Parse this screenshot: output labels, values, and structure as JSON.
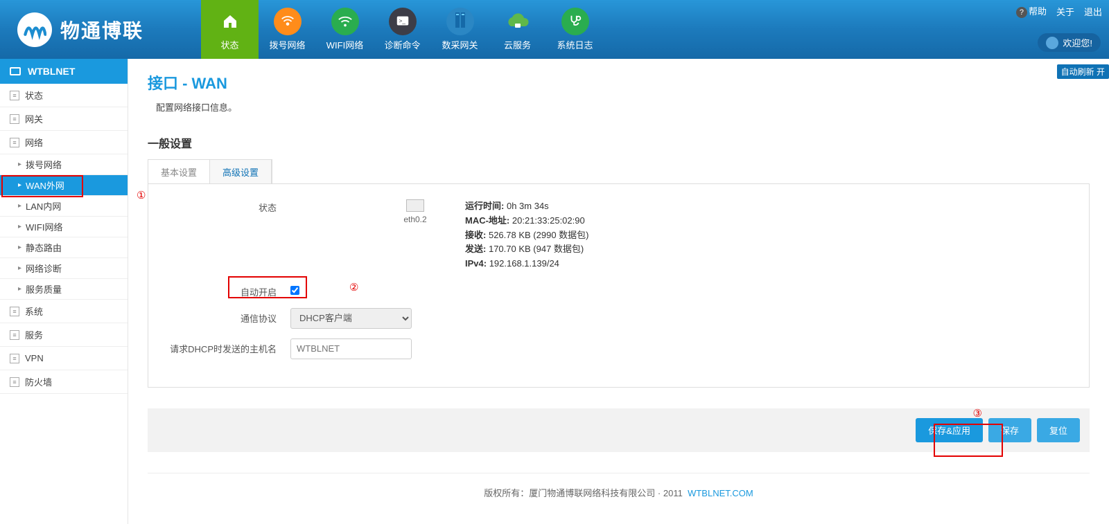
{
  "brand": "物通博联",
  "top_right": {
    "help": "帮助",
    "about": "关于",
    "logout": "退出"
  },
  "welcome": "欢迎您!",
  "topnav": [
    {
      "label": "状态",
      "icon": "home",
      "color": "green",
      "active": true
    },
    {
      "label": "拨号网络",
      "icon": "signal",
      "color": "orange"
    },
    {
      "label": "WIFI网络",
      "icon": "wifi",
      "color": "green2"
    },
    {
      "label": "诊断命令",
      "icon": "terminal",
      "color": "dark"
    },
    {
      "label": "数采网关",
      "icon": "server",
      "color": "blue"
    },
    {
      "label": "云服务",
      "icon": "cloud",
      "color": "cloud"
    },
    {
      "label": "系统日志",
      "icon": "stetho",
      "color": "green2"
    }
  ],
  "sidebar": {
    "title": "WTBLNET",
    "groups": [
      {
        "label": "状态"
      },
      {
        "label": "网关"
      },
      {
        "label": "网络",
        "expanded": true,
        "children": [
          {
            "label": "拨号网络"
          },
          {
            "label": "WAN外网",
            "active": true
          },
          {
            "label": "LAN内网"
          },
          {
            "label": "WIFI网络"
          },
          {
            "label": "静态路由"
          },
          {
            "label": "网络诊断"
          },
          {
            "label": "服务质量"
          }
        ]
      },
      {
        "label": "系统"
      },
      {
        "label": "服务"
      },
      {
        "label": "VPN"
      },
      {
        "label": "防火墙"
      }
    ]
  },
  "page": {
    "title": "接口 - WAN",
    "subtitle": "配置网络接口信息。",
    "section": "一般设置",
    "autorefresh": "自动刷新 开",
    "tabs": {
      "basic": "基本设置",
      "adv": "高级设置"
    },
    "status_label": "状态",
    "iface_name": "eth0.2",
    "status": {
      "uptime_l": "运行时间:",
      "uptime_v": "0h 3m 34s",
      "mac_l": "MAC-地址:",
      "mac_v": "20:21:33:25:02:90",
      "rx_l": "接收:",
      "rx_v": "526.78 KB (2990 数据包)",
      "tx_l": "发送:",
      "tx_v": "170.70 KB (947 数据包)",
      "ip_l": "IPv4:",
      "ip_v": "192.168.1.139/24"
    },
    "auto_label": "自动开启",
    "auto_checked": true,
    "proto_label": "通信协议",
    "proto_value": "DHCP客户端",
    "host_label": "请求DHCP时发送的主机名",
    "host_placeholder": "WTBLNET",
    "buttons": {
      "apply": "保存&应用",
      "save": "保存",
      "reset": "复位"
    }
  },
  "footer": {
    "copy": "版权所有：厦门物通博联网络科技有限公司",
    "year": "2011",
    "link": "WTBLNET.COM"
  },
  "annot": {
    "n1": "①",
    "n2": "②",
    "n3": "③"
  }
}
